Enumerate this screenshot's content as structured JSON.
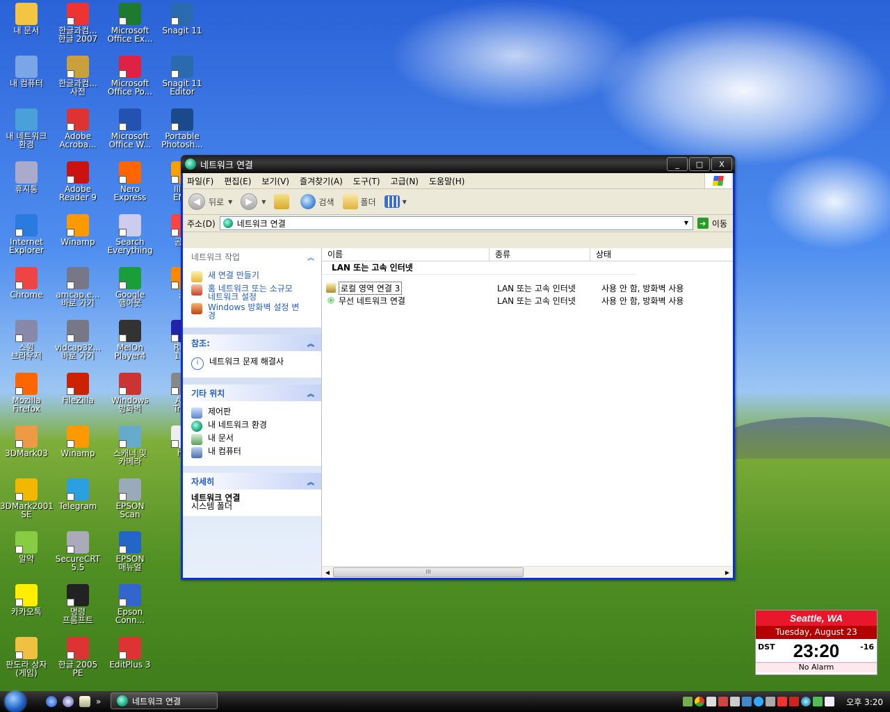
{
  "desktop": {
    "icons": [
      {
        "label": "내 문서"
      },
      {
        "label": "내 컴퓨터"
      },
      {
        "label": "내 네트워크\n환경"
      },
      {
        "label": "휴지통"
      },
      {
        "label": "Internet\nExplorer"
      },
      {
        "label": "Chrome"
      },
      {
        "label": "스윙\n브라우저"
      },
      {
        "label": "Mozilla\nFirefox"
      },
      {
        "label": "3DMark03"
      },
      {
        "label": "3DMark2001\nSE"
      },
      {
        "label": "알약"
      },
      {
        "label": "카카오톡"
      },
      {
        "label": "판도라 상자\n(게임)"
      },
      {
        "label": "한글과컴...\n한글 2007"
      },
      {
        "label": "한글과컴...\n사전"
      },
      {
        "label": "Adobe\nAcroba..."
      },
      {
        "label": "Adobe\nReader 9"
      },
      {
        "label": "Winamp"
      },
      {
        "label": "amcap.e...\n바로 가기"
      },
      {
        "label": "vidcap32...\n바로 가기"
      },
      {
        "label": "FileZilla"
      },
      {
        "label": "Winamp"
      },
      {
        "label": "Telegram"
      },
      {
        "label": "SecureCRT\n5.5"
      },
      {
        "label": "명령\n프롬프트"
      },
      {
        "label": "한글 2005\nPE"
      },
      {
        "label": "Microsoft\nOffice Ex..."
      },
      {
        "label": "Microsoft\nOffice Po..."
      },
      {
        "label": "Microsoft\nOffice W..."
      },
      {
        "label": "Nero\nExpress"
      },
      {
        "label": "Search\nEverything"
      },
      {
        "label": "Google\n행아웃"
      },
      {
        "label": "MelOn\nPlayer4"
      },
      {
        "label": "Windows\n방화벽"
      },
      {
        "label": "스캐너 및\n카메라"
      },
      {
        "label": "EPSON\nScan"
      },
      {
        "label": "EPSON\n매뉴얼"
      },
      {
        "label": "Epson\nConn..."
      },
      {
        "label": "EditPlus 3"
      },
      {
        "label": "Snagit 11"
      },
      {
        "label": "Snagit 11\nEditor"
      },
      {
        "label": "Portable\nPhotosh..."
      },
      {
        "label": "Illus\nENG"
      },
      {
        "label": "곰플"
      },
      {
        "label": "곰"
      },
      {
        "label": "REA\n11n"
      },
      {
        "label": "Acr\nTrue"
      },
      {
        "label": "hc"
      }
    ]
  },
  "window": {
    "title": "네트워크 연결",
    "buttons": {
      "minimize": "_",
      "maximize": "□",
      "close": "X"
    },
    "menu": [
      "파일(F)",
      "편집(E)",
      "보기(V)",
      "즐겨찾기(A)",
      "도구(T)",
      "고급(N)",
      "도움말(H)"
    ],
    "toolbar": {
      "back": "뒤로",
      "search": "검색",
      "folders": "폴더"
    },
    "address": {
      "label": "주소(D)",
      "value": "네트워크 연결",
      "go": "이동"
    },
    "tasks": {
      "network_tasks": {
        "title": "네트워크 작업",
        "items": [
          "새 연결 만들기",
          "홈 네트워크 또는 소규모\n네트워크 설정",
          "Windows 방화벽 설정 변\n경"
        ]
      },
      "see_also": {
        "title": "참조:",
        "items": [
          "네트워크 문제 해결사"
        ]
      },
      "other_places": {
        "title": "기타 위치",
        "items": [
          "제어판",
          "내 네트워크 환경",
          "내 문서",
          "내 컴퓨터"
        ]
      },
      "details": {
        "title": "자세히",
        "name": "네트워크 연결",
        "type": "시스템 폴더"
      }
    },
    "list": {
      "columns": [
        "이름",
        "종류",
        "상태"
      ],
      "group": "LAN 또는 고속 인터넷",
      "rows": [
        {
          "name": "로컬 영역 연결 3",
          "type": "LAN 또는 고속 인터넷",
          "status": "사용 안 함, 방화벽 사용"
        },
        {
          "name": "무선 네트워크 연결",
          "type": "LAN 또는 고속 인터넷",
          "status": "사용 안 함, 방화벽 사용"
        }
      ],
      "scroll_marker": "III"
    }
  },
  "taskbar": {
    "task": "네트워크 연결",
    "more": "»",
    "clock": "오후 3:20"
  },
  "widget": {
    "city": "Seattle, WA",
    "date": "Tuesday, August 23",
    "dst": "DST",
    "time": "23:20",
    "offset": "-16",
    "alarm": "No Alarm"
  }
}
